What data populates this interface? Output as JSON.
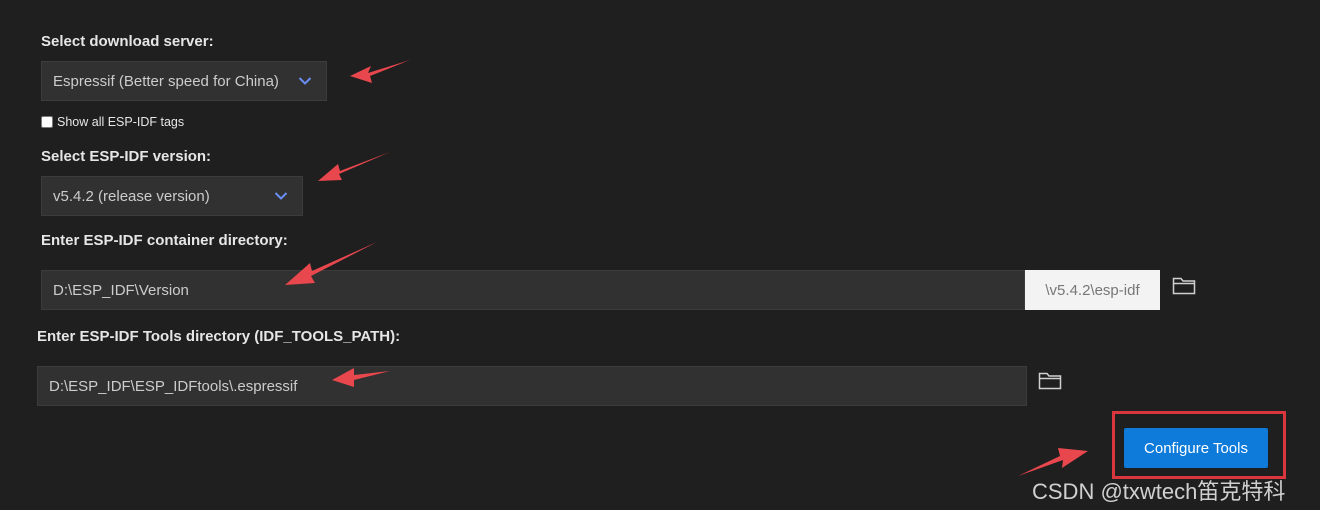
{
  "download_server": {
    "label": "Select download server:",
    "selected": "Espressif (Better speed for China)",
    "chevron_icon": "chevron-down-icon"
  },
  "show_all_tags": {
    "label": "Show all ESP-IDF tags",
    "checked": false
  },
  "idf_version": {
    "label": "Select ESP-IDF version:",
    "selected": "v5.4.2 (release version)",
    "chevron_icon": "chevron-down-icon"
  },
  "container_dir": {
    "label": "Enter ESP-IDF container directory:",
    "value": "D:\\ESP_IDF\\Version",
    "suffix": "\\v5.4.2\\esp-idf",
    "browse_icon": "folder-icon"
  },
  "tools_dir": {
    "label": "Enter ESP-IDF Tools directory (IDF_TOOLS_PATH):",
    "value": "D:\\ESP_IDF\\ESP_IDFtools\\.espressif",
    "browse_icon": "folder-icon"
  },
  "configure_button": {
    "label": "Configure Tools"
  },
  "watermark": "CSDN @txwtech笛克特科",
  "colors": {
    "background": "#1f1f1f",
    "accent": "#0e7ad9",
    "annotation": "#e8474d"
  }
}
